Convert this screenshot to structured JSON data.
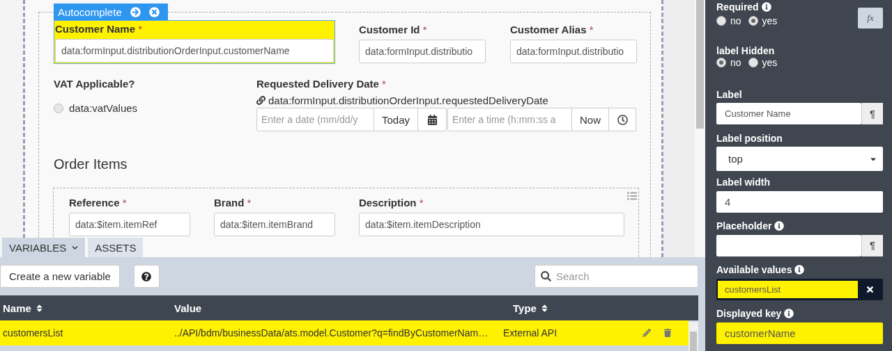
{
  "canvas": {
    "badge": {
      "label": "Autocomplete"
    },
    "top_fields": [
      {
        "label": "Customer Name",
        "required_mark": "*",
        "value": "data:formInput.distributionOrderInput.customerName",
        "selected": true
      },
      {
        "label": "Customer Id",
        "required_mark": "*",
        "value": "data:formInput.distributio",
        "selected": false
      },
      {
        "label": "Customer Alias",
        "required_mark": "*",
        "value": "data:formInput.distributio",
        "selected": false
      }
    ],
    "vat": {
      "label": "VAT Applicable?",
      "options": [
        {
          "label": "data:vatValues",
          "selected": false
        }
      ]
    },
    "delivery": {
      "label": "Requested Delivery Date",
      "required_mark": "*",
      "binding": "data:formInput.distributionOrderInput.requestedDeliveryDate",
      "date_placeholder": "Enter a date (mm/dd/y",
      "today_button": "Today",
      "time_placeholder": "Enter a time (h:mm:ss a",
      "now_button": "Now"
    },
    "section_title": "Order Items",
    "item_fields": [
      {
        "label": "Reference",
        "required_mark": "*",
        "value": "data:$item.itemRef"
      },
      {
        "label": "Brand",
        "required_mark": "*",
        "value": "data:$item.itemBrand"
      },
      {
        "label": "Description",
        "required_mark": "*",
        "value": "data:$item.itemDescription"
      }
    ]
  },
  "bottom_tabs": [
    {
      "label": "VARIABLES",
      "selected": true
    },
    {
      "label": "ASSETS",
      "selected": false
    }
  ],
  "variables": {
    "create_button": "Create a new variable",
    "search_placeholder": "Search",
    "columns": [
      {
        "label": "Name",
        "sortable": true
      },
      {
        "label": "Value",
        "sortable": false
      },
      {
        "label": "Type",
        "sortable": true
      }
    ],
    "rows": [
      {
        "name": "customersList",
        "value": "../API/bdm/businessData/ats.model.Customer?q=findByCustomerNam…",
        "type": "External API",
        "selected": true
      }
    ]
  },
  "properties": [
    {
      "kind": "radio",
      "label": "Required",
      "info": true,
      "options": [
        {
          "label": "no",
          "selected": false
        },
        {
          "label": "yes",
          "selected": true
        }
      ],
      "side_button": "fx"
    },
    {
      "kind": "radio",
      "label": "label Hidden",
      "info": false,
      "options": [
        {
          "label": "no",
          "selected": true
        },
        {
          "label": "yes",
          "selected": false
        }
      ]
    },
    {
      "kind": "text",
      "label": "Label",
      "info": false,
      "value": "Customer Name",
      "suffix": "¶",
      "highlighted": false
    },
    {
      "kind": "select",
      "label": "Label position",
      "info": false,
      "value": "top"
    },
    {
      "kind": "text",
      "label": "Label width",
      "info": false,
      "value": "4",
      "highlighted": false
    },
    {
      "kind": "text",
      "label": "Placeholder",
      "info": true,
      "suffix": "¶",
      "highlighted": false
    },
    {
      "kind": "tags",
      "label": "Available values",
      "info": true,
      "value": "customersList",
      "highlighted": true
    },
    {
      "kind": "text",
      "label": "Displayed key",
      "info": true,
      "value": "customerName",
      "highlighted": true
    }
  ]
}
